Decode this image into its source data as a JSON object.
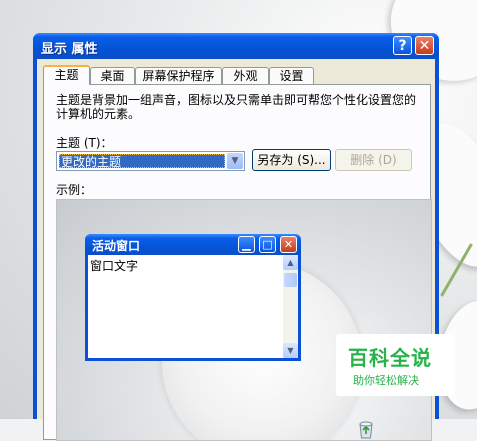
{
  "window": {
    "title": "显示 属性",
    "help_button": "?",
    "close_button": "✕"
  },
  "tabs": [
    {
      "label": "主题",
      "active": true
    },
    {
      "label": "桌面",
      "active": false
    },
    {
      "label": "屏幕保护程序",
      "active": false
    },
    {
      "label": "外观",
      "active": false
    },
    {
      "label": "设置",
      "active": false
    }
  ],
  "themes_panel": {
    "description": "主题是背景加一组声音，图标以及只需单击即可帮您个性化设置您的计算机的元素。",
    "theme_label": "主题 (T)：",
    "theme_value": "更改的主题",
    "save_as_button": "另存为 (S)...",
    "delete_button": "删除 (D)",
    "preview_label": "示例："
  },
  "preview_window": {
    "title": "活动窗口",
    "body_text": "窗口文字",
    "min_icon": "minimize-icon",
    "max_icon": "maximize-icon",
    "close_icon": "close-icon"
  },
  "watermark": {
    "title": "百科全说",
    "subtitle": "助你轻松解决"
  },
  "colors": {
    "titlebar": "#0453d6",
    "dialog_face": "#ece9d8",
    "selection": "#316ac5",
    "watermark_green": "#27b24a"
  }
}
